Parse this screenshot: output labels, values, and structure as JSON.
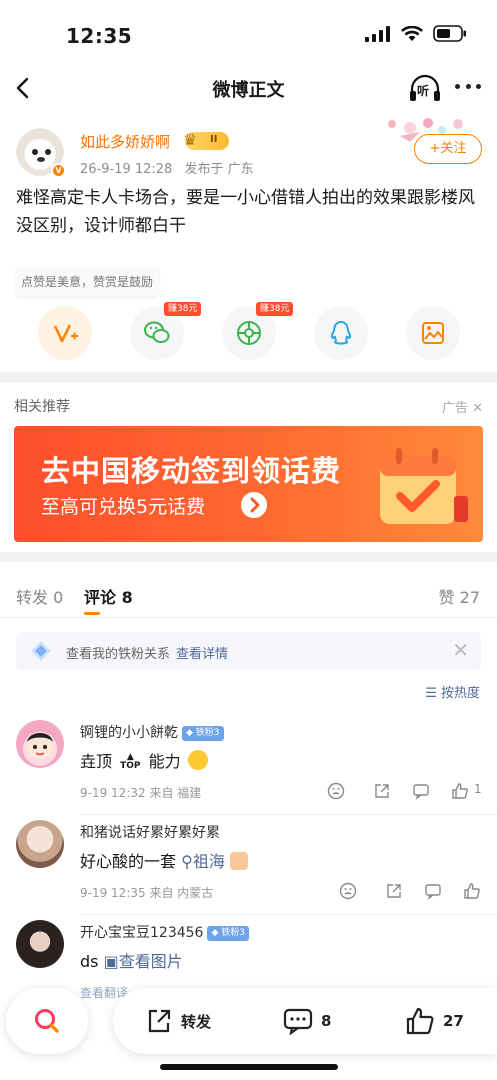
{
  "status_bar": {
    "time": "12:35"
  },
  "nav": {
    "title": "微博正文",
    "listen_label": "听"
  },
  "post": {
    "username": "如此多娇娇啊",
    "level": "II",
    "date": "26-9-19 12:28",
    "location": "发布于 广东",
    "follow_label": "+关注",
    "text": "难怪高定卡人卡场合，要是一小心借错人拍出的效果跟影楼风没区别，设计师都白干"
  },
  "reward_tip": "点赞是美意，赞赏是鼓励",
  "share_tags": {
    "wechat": "赚38元",
    "moments": "赚38元"
  },
  "recommend": {
    "title": "相关推荐",
    "ad_label": "广告",
    "ad_headline": "去中国移动签到领话费",
    "ad_sub": "至高可兑换5元话费"
  },
  "tabs": {
    "repost": "转发 0",
    "comment": "评论 8",
    "like": "赞 27"
  },
  "fans_bar": {
    "text": "查看我的铁粉关系",
    "link": "查看详情"
  },
  "sort_label": "按热度",
  "comments": [
    {
      "name": "锕锂的小小餅乾",
      "fan_badge": "铁粉3",
      "text_parts": [
        "垚顶",
        "TOP",
        "能力"
      ],
      "meta": "9-19 12:32  来自 福建",
      "like_count": "1"
    },
    {
      "name": "和猪说话好累好累好累",
      "text": "好心酸的一套",
      "topic": "祖海",
      "meta": "9-19 12:35  来自 内蒙古"
    },
    {
      "name": "开心宝宝豆123456",
      "fan_badge": "铁粉3",
      "text": "ds",
      "link": "查看图片",
      "translate": "查看翻译"
    }
  ],
  "bottom_bar": {
    "repost": "转发",
    "comment_count": "8",
    "like_count": "27"
  },
  "colors": {
    "accent": "#ff8200",
    "link": "#506a96",
    "ad": "#ff4e2c"
  }
}
